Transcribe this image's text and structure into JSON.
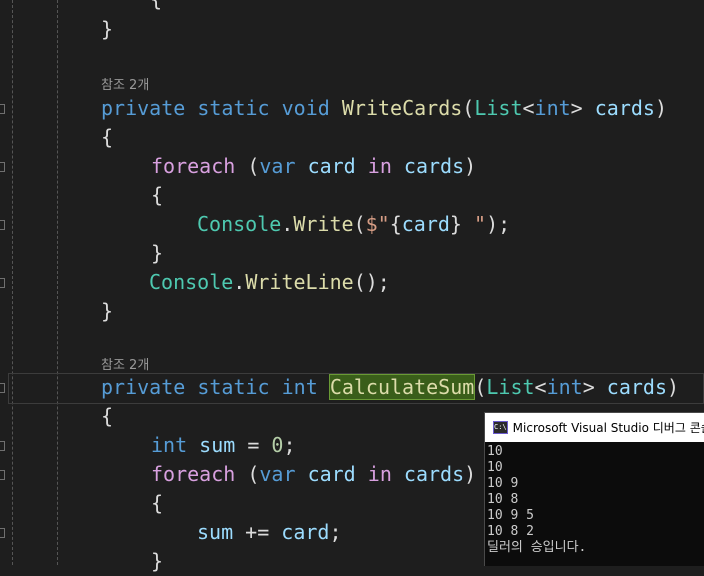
{
  "editor": {
    "ref_label_1": "참조 2개",
    "ref_label_2": "참조 2개",
    "brace_partial": "{",
    "close_brace": "}",
    "open_brace": "{",
    "kw_private": "private",
    "kw_static": "static",
    "kw_void": "void",
    "kw_int": "int",
    "kw_foreach": "foreach",
    "kw_var": "var",
    "kw_in": "in",
    "type_list": "List",
    "lt": "<",
    "gt": ">",
    "open_paren": "(",
    "close_paren": ")",
    "method_writecards": "WriteCards",
    "method_calculatesum": "CalculateSum",
    "method_write": "Write",
    "method_writeline": "WriteLine",
    "class_console": "Console",
    "dot": ".",
    "param_cards": "cards",
    "var_card": "card",
    "var_sum": "sum",
    "dollar": "$",
    "str_quote_open": "\"",
    "str_tail": " \"",
    "interp_open": "{",
    "interp_close": "}",
    "semi_paren": ");",
    "empty_call": "();",
    "eq": " = ",
    "zero": "0",
    "semi": ";",
    "plus_eq": " += "
  },
  "console": {
    "title": "Microsoft Visual Studio 디버그 콘솔",
    "icon_text": "C:\\",
    "lines": [
      "10",
      "10",
      "10 9",
      "10 8",
      "10 9 5",
      "10 8 2",
      "딜러의 승입니다."
    ]
  }
}
